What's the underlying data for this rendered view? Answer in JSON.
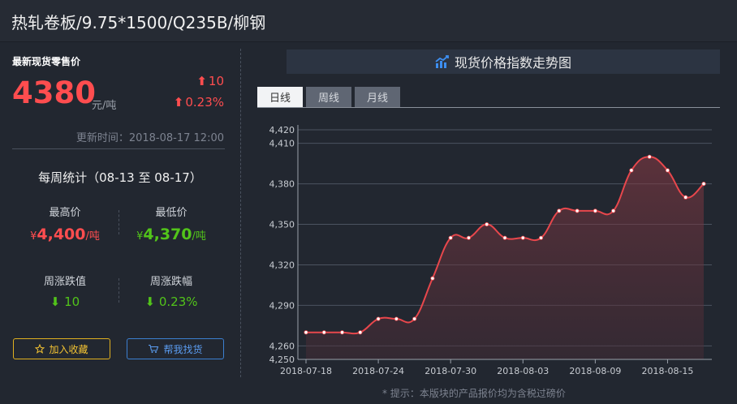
{
  "header": {
    "title": "热轧卷板/9.75*1500/Q235B/柳钢"
  },
  "price": {
    "label": "最新现货零售价",
    "value": "4380",
    "unit": "元/吨",
    "change_abs": "10",
    "change_pct": "0.23%",
    "update_time": "更新时间：2018-08-17 12:00"
  },
  "weekly": {
    "title": "每周统计（08-13 至 08-17）",
    "high_label": "最高价",
    "high_prefix": "¥",
    "high_value": "4,400",
    "high_unit": "/吨",
    "low_label": "最低价",
    "low_prefix": "¥",
    "low_value": "4,370",
    "low_unit": "/吨",
    "change_label": "周涨跌值",
    "change_value": "10",
    "pct_label": "周涨跌幅",
    "pct_value": "0.23%"
  },
  "buttons": {
    "favorite": "加入收藏",
    "find": "帮我找货"
  },
  "chart_header": {
    "title": "现货价格指数走势图"
  },
  "tabs": [
    {
      "label": "日线"
    },
    {
      "label": "周线"
    },
    {
      "label": "月线"
    }
  ],
  "note": "* 提示：本版块的产品报价均为含税过磅价",
  "colors": {
    "up": "#ff4d4f",
    "down": "#52c41a",
    "line": "#e8474c"
  },
  "icons": {
    "up": "arrow-up-icon",
    "down": "arrow-down-icon",
    "star": "star-icon",
    "cart": "cart-icon",
    "chart": "trend-chart-icon"
  },
  "chart_data": {
    "type": "line",
    "x": [
      "2018-07-18",
      "2018-07-19",
      "2018-07-20",
      "2018-07-23",
      "2018-07-24",
      "2018-07-25",
      "2018-07-26",
      "2018-07-27",
      "2018-07-30",
      "2018-07-31",
      "2018-08-01",
      "2018-08-02",
      "2018-08-03",
      "2018-08-06",
      "2018-08-07",
      "2018-08-08",
      "2018-08-09",
      "2018-08-10",
      "2018-08-13",
      "2018-08-14",
      "2018-08-15",
      "2018-08-16",
      "2018-08-17"
    ],
    "series": [
      {
        "values": [
          4270,
          4270,
          4270,
          4270,
          4280,
          4280,
          4280,
          4310,
          4340,
          4340,
          4350,
          4340,
          4340,
          4340,
          4360,
          4360,
          4360,
          4360,
          4390,
          4400,
          4390,
          4370,
          4380
        ]
      }
    ],
    "xticks": [
      "2018-07-18",
      "2018-07-24",
      "2018-07-30",
      "2018-08-03",
      "2018-08-09",
      "2018-08-15"
    ],
    "xtick_index": [
      0,
      4,
      8,
      12,
      16,
      20
    ],
    "yticks": [
      4250,
      4260,
      4290,
      4320,
      4350,
      4380,
      4410,
      4420
    ],
    "ylim": [
      4250,
      4420
    ],
    "grid": true,
    "legend": "none"
  }
}
